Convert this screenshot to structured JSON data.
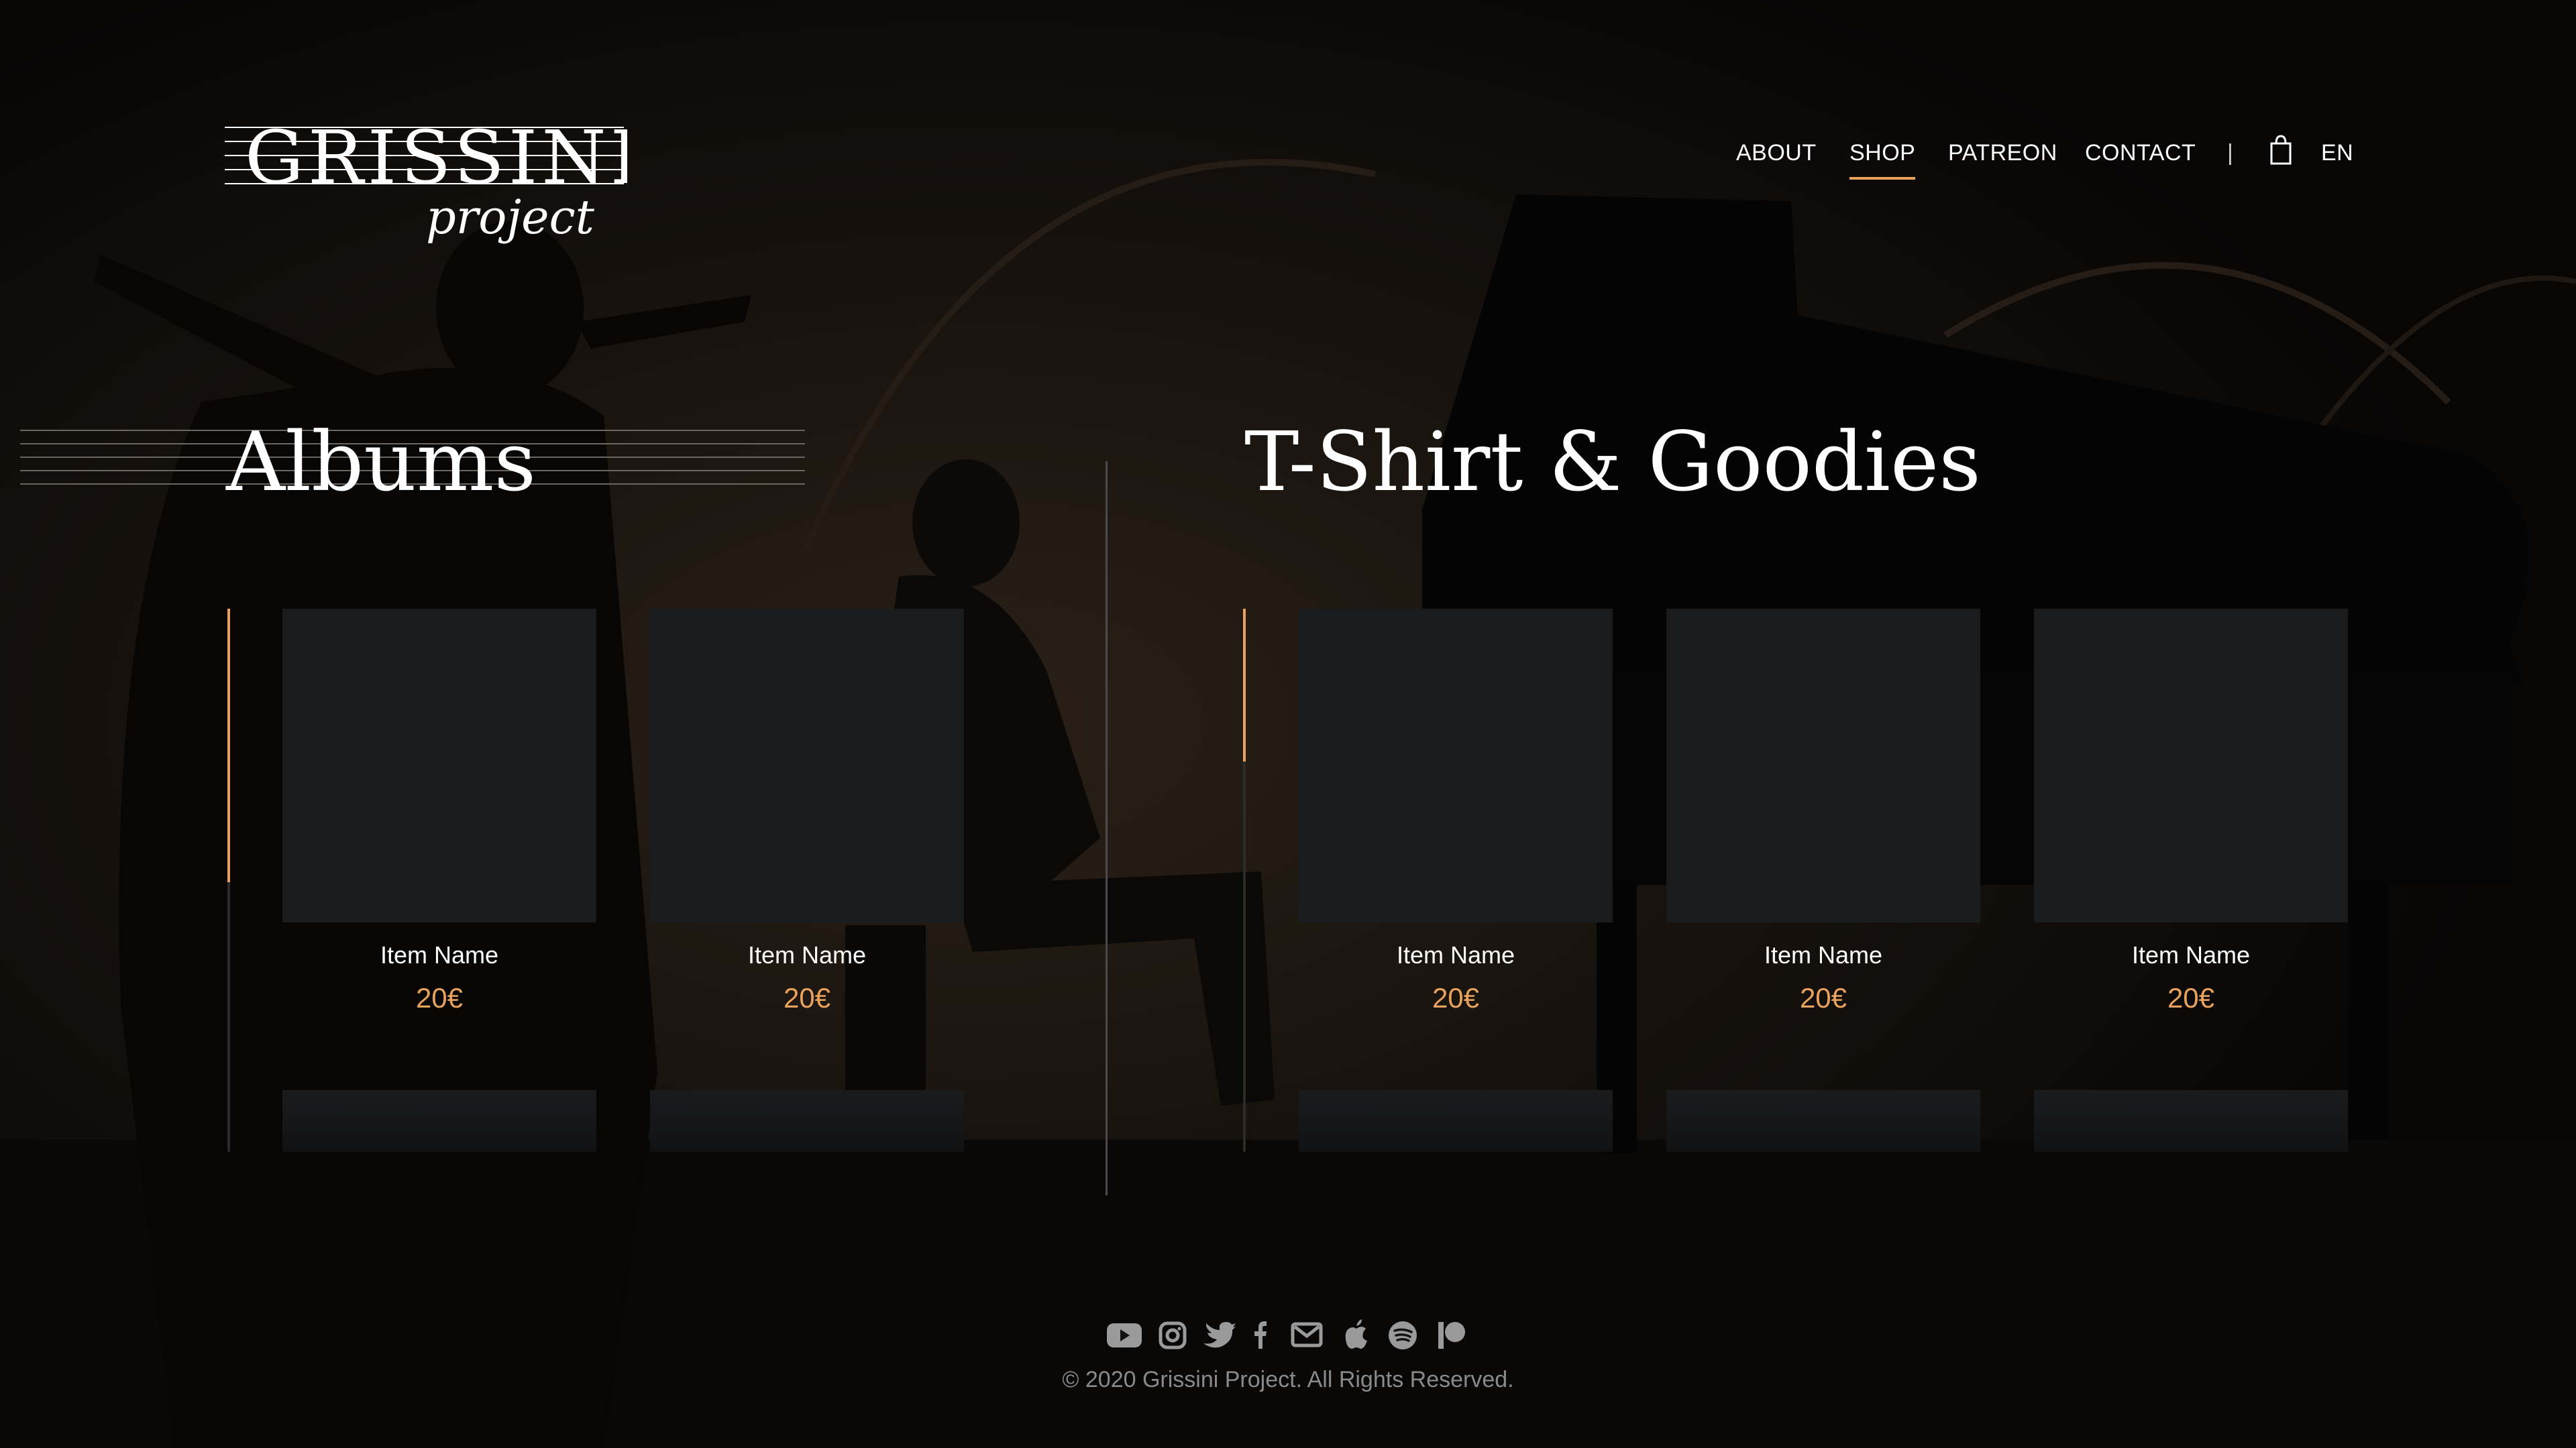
{
  "brand": {
    "logo_text": "GRISSINI",
    "logo_subtext": "project"
  },
  "nav": {
    "items": [
      {
        "label": "ABOUT"
      },
      {
        "label": "SHOP",
        "active": true
      },
      {
        "label": "PATREON"
      },
      {
        "label": "CONTACT"
      }
    ],
    "separator": "|",
    "cart_icon": "shopping-bag-icon",
    "language": "EN"
  },
  "sections": {
    "albums": {
      "title": "Albums",
      "items": [
        {
          "name": "Item Name",
          "price": "20€"
        },
        {
          "name": "Item Name",
          "price": "20€"
        }
      ]
    },
    "goodies": {
      "title": "T-Shirt & Goodies",
      "items": [
        {
          "name": "Item Name",
          "price": "20€"
        },
        {
          "name": "Item Name",
          "price": "20€"
        },
        {
          "name": "Item Name",
          "price": "20€"
        }
      ]
    }
  },
  "footer": {
    "social_icons": [
      "youtube-icon",
      "instagram-icon",
      "twitter-icon",
      "facebook-icon",
      "email-icon",
      "apple-icon",
      "spotify-icon",
      "patreon-icon"
    ],
    "copyright": "© 2020 Grissini Project. All Rights Reserved."
  },
  "colors": {
    "accent": "#e8a25c",
    "background": "#0b0908",
    "card": "#1a1b1d",
    "muted_text": "#8a8a8a"
  }
}
